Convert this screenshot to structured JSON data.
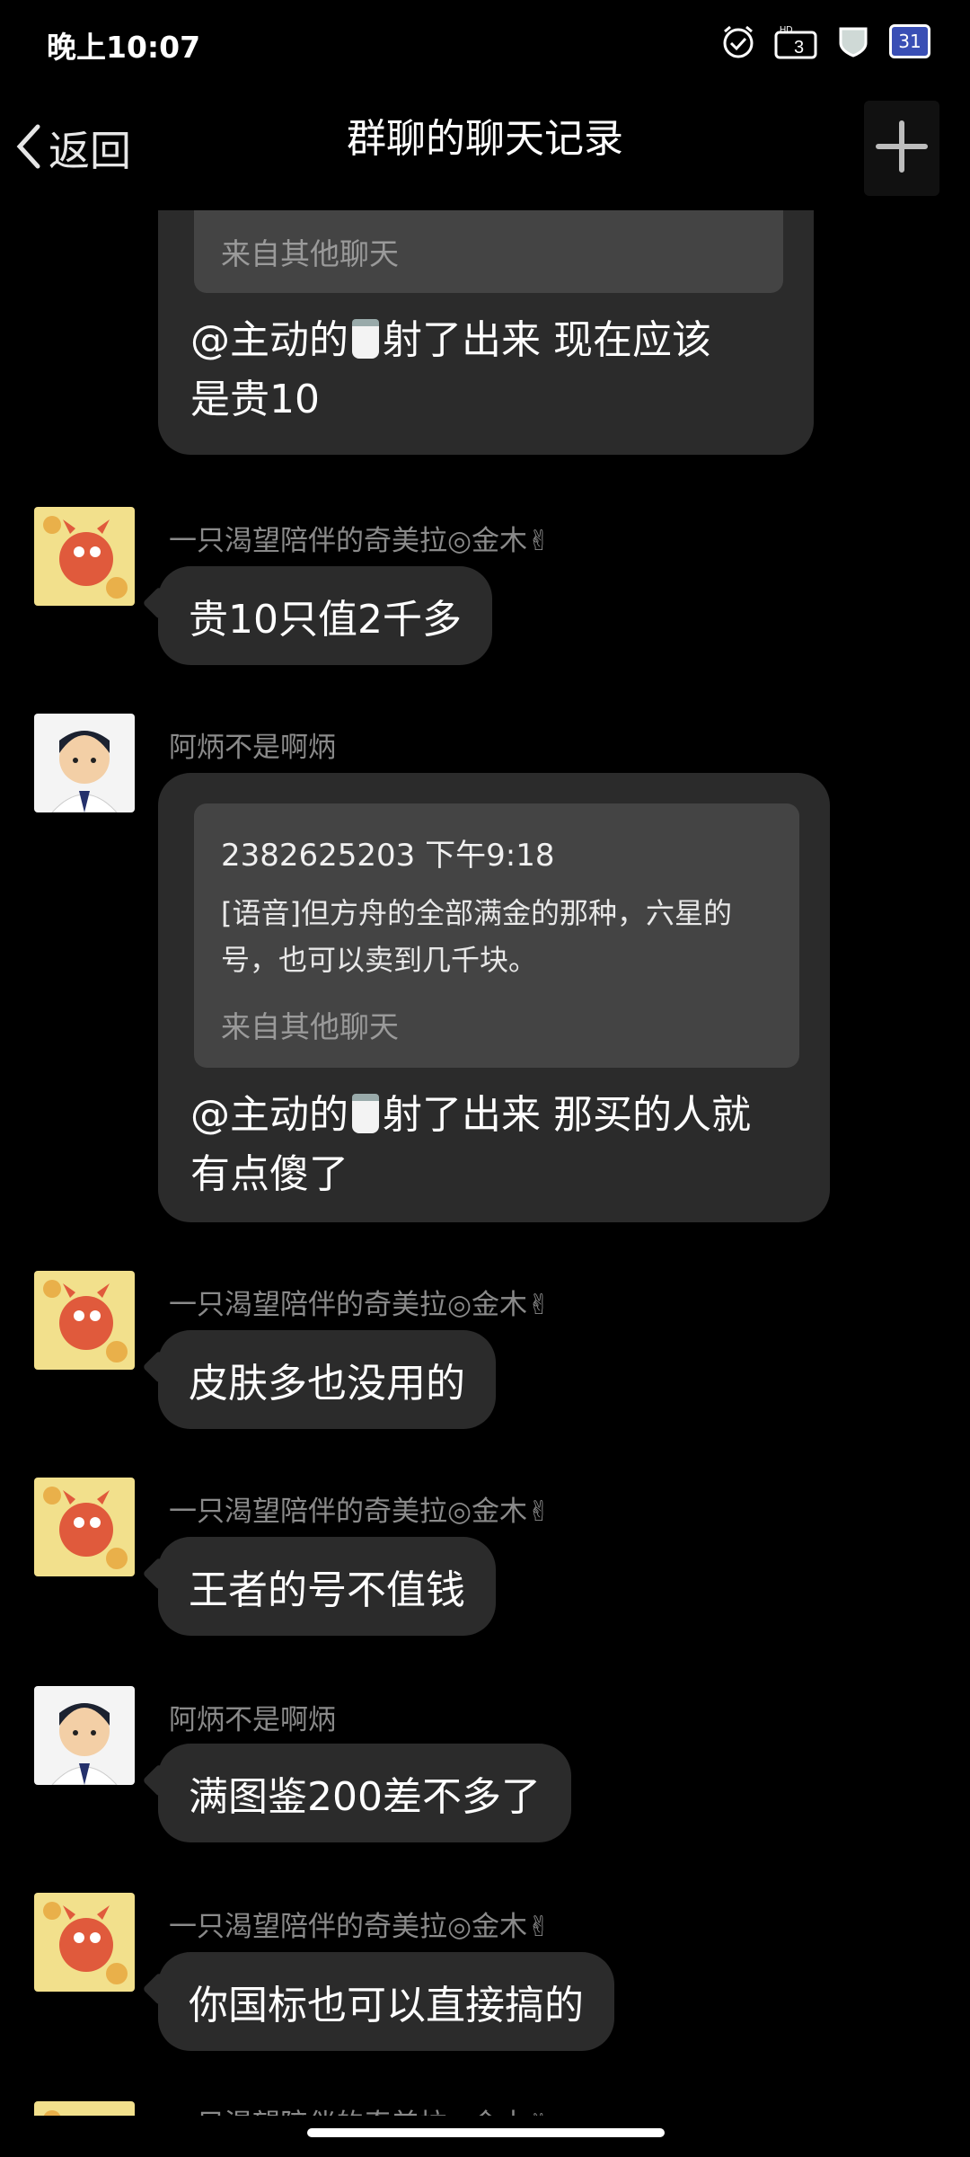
{
  "status_bar": {
    "time": "晚上10:07",
    "battery_level": "31"
  },
  "header": {
    "back_label": "返回",
    "title": "群聊的聊天记录"
  },
  "messages": [
    {
      "type": "quote_card_partial",
      "quote_source": "来自其他聊天",
      "text_line1": "@主动的",
      "text_line1_after": "射了出来 现在应该",
      "text_line2": "是贵10"
    },
    {
      "sender": "一只渴望陪伴的奇美拉◎金木✌",
      "avatar": "fox-avatar",
      "text": "贵10只值2千多"
    },
    {
      "sender": "阿炳不是啊炳",
      "avatar": "man-avatar",
      "quote_meta": "2382625203 下午9:18",
      "quote_text_line1": "[语音]但方舟的全部满金的那种，六星的",
      "quote_text_line2": "号，也可以卖到几千块。",
      "quote_source": "来自其他聊天",
      "text_line1": "@主动的",
      "text_line1_after": "射了出来 那买的人就",
      "text_line2": "有点傻了"
    },
    {
      "sender": "一只渴望陪伴的奇美拉◎金木✌",
      "avatar": "fox-avatar",
      "text": "皮肤多也没用的"
    },
    {
      "sender": "一只渴望陪伴的奇美拉◎金木✌",
      "avatar": "fox-avatar",
      "text": "王者的号不值钱"
    },
    {
      "sender": "阿炳不是啊炳",
      "avatar": "man-avatar",
      "text": "满图鉴200差不多了"
    },
    {
      "sender": "一只渴望陪伴的奇美拉◎金木✌",
      "avatar": "fox-avatar",
      "text": "你国标也可以直接搞的"
    },
    {
      "sender": "一只渴望陪伴的奇美拉◎金木✌",
      "avatar": "fox-avatar",
      "partial": true
    }
  ],
  "colors": {
    "background": "#000000",
    "bubble": "#2b2b2b",
    "quote": "#444444",
    "name": "#8a8a8a"
  },
  "icons": [
    "alarm-check-icon",
    "hd-signal-icon",
    "shield-icon",
    "calendar-31-icon",
    "chevron-left-icon",
    "plus-icon",
    "milk-emoji-icon"
  ]
}
